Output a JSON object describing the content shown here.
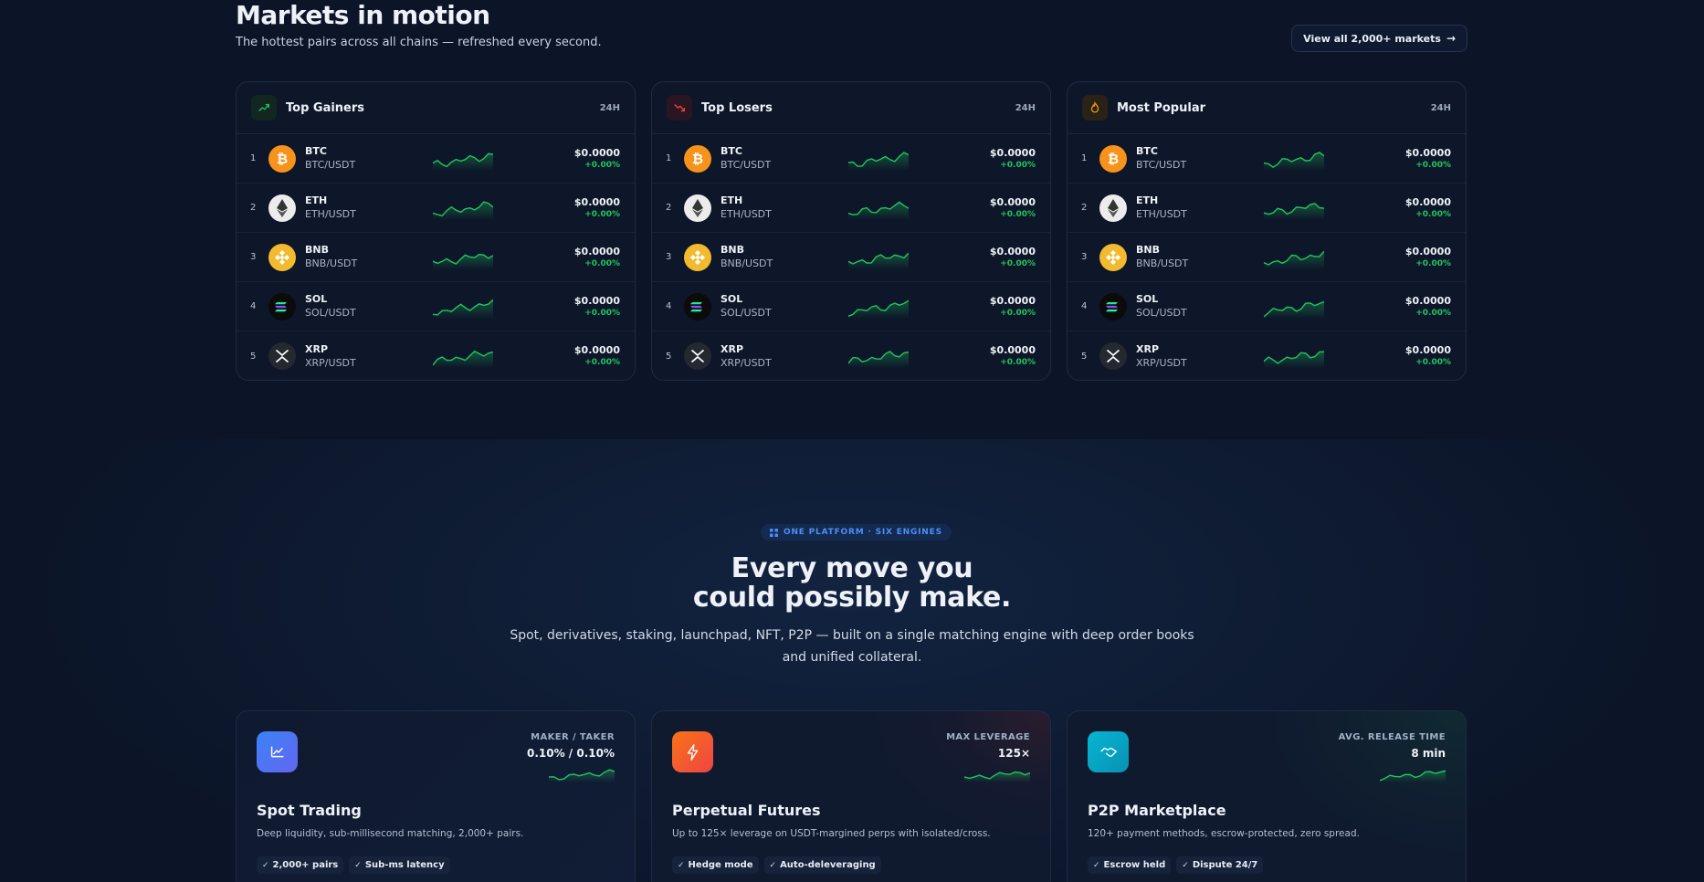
{
  "markets": {
    "title": "Markets in motion",
    "subtitle": "The hottest pairs across all chains — refreshed every second.",
    "view_all": "View all 2,000+ markets",
    "cards": [
      {
        "title": "Top Gainers",
        "period": "24H",
        "icon": "trend-up-icon",
        "icon_color": "#22c55e"
      },
      {
        "title": "Top Losers",
        "period": "24H",
        "icon": "trend-down-icon",
        "icon_color": "#ef4444"
      },
      {
        "title": "Most Popular",
        "period": "24H",
        "icon": "flame-icon",
        "icon_color": "#f59e0b"
      }
    ],
    "rows": [
      {
        "rank": "1",
        "symbol": "BTC",
        "pair": "BTC/USDT",
        "price": "$0.0000",
        "change": "+0.00%",
        "coin_color": "#f7931a"
      },
      {
        "rank": "2",
        "symbol": "ETH",
        "pair": "ETH/USDT",
        "price": "$0.0000",
        "change": "+0.00%",
        "coin_color": "#e8e8e8"
      },
      {
        "rank": "3",
        "symbol": "BNB",
        "pair": "BNB/USDT",
        "price": "$0.0000",
        "change": "+0.00%",
        "coin_color": "#f3ba2f"
      },
      {
        "rank": "4",
        "symbol": "SOL",
        "pair": "SOL/USDT",
        "price": "$0.0000",
        "change": "+0.00%",
        "coin_color": "#111111"
      },
      {
        "rank": "5",
        "symbol": "XRP",
        "pair": "XRP/USDT",
        "price": "$0.0000",
        "change": "+0.00%",
        "coin_color": "#23292f"
      }
    ]
  },
  "engines": {
    "badge": "ONE PLATFORM · SIX ENGINES",
    "headline_1": "Every move you",
    "headline_2": "could possibly make.",
    "lede": "Spot, derivatives, staking, launchpad, NFT, P2P — built on a single matching engine with deep order books and unified collateral.",
    "features": [
      {
        "title": "Spot Trading",
        "desc": "Deep liquidity, sub-millisecond matching, 2,000+ pairs.",
        "stat_label": "MAKER / TAKER",
        "stat_value": "0.10% / 0.10%",
        "chips": [
          "2,000+ pairs",
          "Sub-ms latency"
        ],
        "icon": "chart-icon"
      },
      {
        "title": "Perpetual Futures",
        "desc": "Up to 125× leverage on USDT-margined perps with isolated/cross.",
        "stat_label": "MAX LEVERAGE",
        "stat_value": "125×",
        "chips": [
          "Hedge mode",
          "Auto-deleveraging"
        ],
        "icon": "bolt-icon"
      },
      {
        "title": "P2P Marketplace",
        "desc": "120+ payment methods, escrow-protected, zero spread.",
        "stat_label": "AVG. RELEASE TIME",
        "stat_value": "8 min",
        "chips": [
          "Escrow held",
          "Dispute 24/7"
        ],
        "icon": "handshake-icon"
      }
    ]
  },
  "colors": {
    "accent": "#22c55e",
    "badge": "#4c8ef7",
    "bg": "#0c1528"
  }
}
